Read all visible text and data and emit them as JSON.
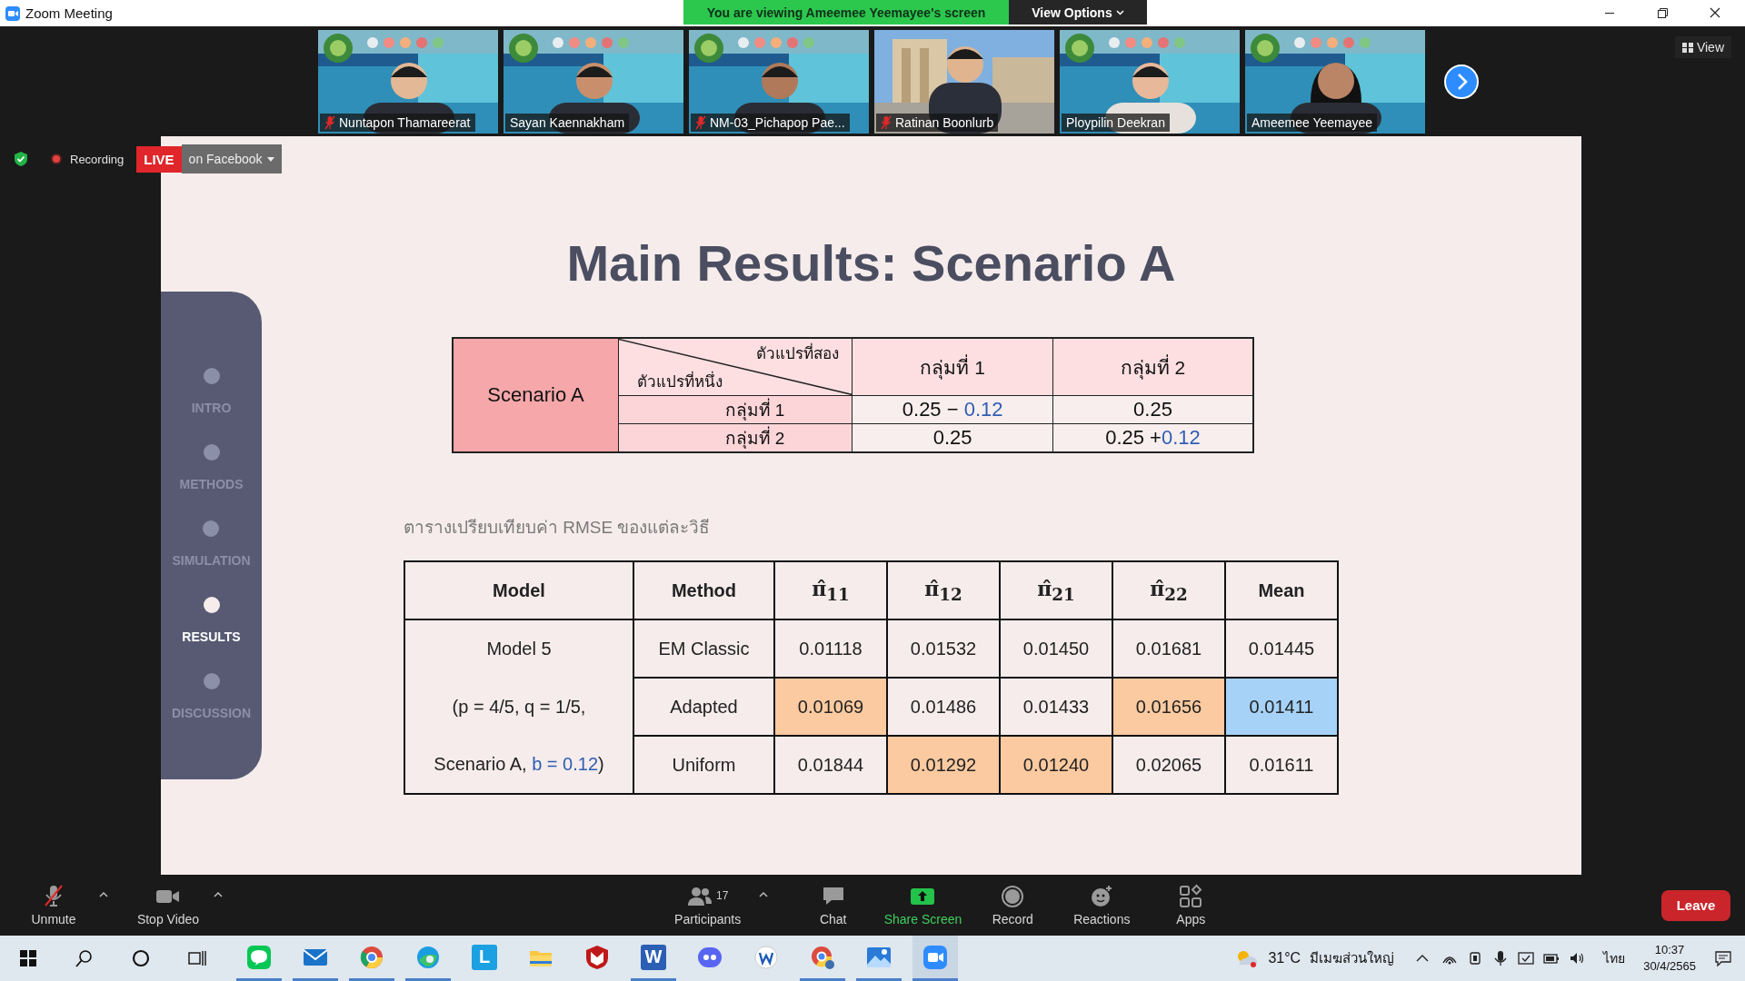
{
  "window": {
    "title": "Zoom Meeting"
  },
  "share_banner": {
    "text": "You are viewing Ameemee Yeemayee's screen",
    "button": "View Options"
  },
  "participants": [
    {
      "name": "Nuntapon Thamareerat",
      "muted": true
    },
    {
      "name": "Sayan Kaennakham",
      "muted": false
    },
    {
      "name": "NM-03_Pichapop Pae...",
      "muted": true
    },
    {
      "name": "Ratinan Boonlurb",
      "muted": true
    },
    {
      "name": "Ploypilin Deekran",
      "muted": false
    },
    {
      "name": "Ameemee Yeemayee",
      "muted": false
    }
  ],
  "view_button": "View",
  "recording": {
    "label": "Recording",
    "live": "LIVE",
    "destination": "on Facebook"
  },
  "slide": {
    "title": "Main Results: Scenario A",
    "nav": [
      {
        "label": "INTRO",
        "selected": false
      },
      {
        "label": "METHODS",
        "selected": false
      },
      {
        "label": "SIMULATION",
        "selected": false
      },
      {
        "label": "RESULTS",
        "selected": true
      },
      {
        "label": "DISCUSSION",
        "selected": false
      }
    ],
    "scenario_table": {
      "label": "Scenario A",
      "column_header": "ตัวแปรที่สอง",
      "row_header": "ตัวแปรที่หนึ่ง",
      "columns": [
        "กลุ่มที่ 1",
        "กลุ่มที่ 2"
      ],
      "rows": [
        {
          "label": "กลุ่มที่ 1",
          "cells": [
            [
              {
                "text": "0.25 − ",
                "accent": false
              },
              {
                "text": "0.12",
                "accent": true
              }
            ],
            [
              {
                "text": "0.25",
                "accent": false
              }
            ]
          ]
        },
        {
          "label": "กลุ่มที่ 2",
          "cells": [
            [
              {
                "text": "0.25",
                "accent": false
              }
            ],
            [
              {
                "text": "0.25 +",
                "accent": false
              },
              {
                "text": "0.12",
                "accent": true
              }
            ]
          ]
        }
      ]
    },
    "caption": "ตารางเปรียบเทียบค่า RMSE ของแต่ละวิธี",
    "rmse_table": {
      "columns": [
        "Model",
        "Method",
        "π̂$_{11}$",
        "π̂$_{12}$",
        "π̂$_{21}$",
        "π̂$_{22}$",
        "Mean"
      ],
      "rows": [
        {
          "cells": [
            {
              "text": "Model 5"
            },
            {
              "text": "EM Classic"
            },
            {
              "text": "0.01118"
            },
            {
              "text": "0.01532"
            },
            {
              "text": "0.01450"
            },
            {
              "text": "0.01681"
            },
            {
              "text": "0.01445"
            }
          ]
        },
        {
          "cells": [
            {
              "parts": [
                {
                  "text": "(p = 4/5, q = 1/5,",
                  "accent": false
                }
              ]
            },
            {
              "text": "Adapted"
            },
            {
              "text": "0.01069",
              "color": "#fccaa0"
            },
            {
              "text": "0.01486"
            },
            {
              "text": "0.01433"
            },
            {
              "text": "0.01656",
              "color": "#fccaa0"
            },
            {
              "text": "0.01411",
              "color": "#a6d2f8"
            }
          ]
        },
        {
          "cells": [
            {
              "parts": [
                {
                  "text": "Scenario A, ",
                  "accent": false
                },
                {
                  "text": "b = 0.12",
                  "accent": true
                },
                {
                  "text": ")",
                  "accent": false
                }
              ]
            },
            {
              "text": "Uniform"
            },
            {
              "text": "0.01844"
            },
            {
              "text": "0.01292",
              "color": "#fccaa0"
            },
            {
              "text": "0.01240",
              "color": "#fccaa0"
            },
            {
              "text": "0.02065"
            },
            {
              "text": "0.01611"
            }
          ]
        }
      ]
    }
  },
  "toolbar": {
    "items": [
      {
        "kind": "mic",
        "label": "Unmute",
        "muted": true,
        "menu": true
      },
      {
        "kind": "video",
        "label": "Stop Video",
        "menu": true
      },
      {
        "kind": "participants",
        "label": "Participants",
        "count": "17",
        "menu": true
      },
      {
        "kind": "chat",
        "label": "Chat",
        "menu": false
      },
      {
        "kind": "share",
        "label": "Share Screen",
        "menu": false
      },
      {
        "kind": "record",
        "label": "Record",
        "menu": false
      },
      {
        "kind": "reactions",
        "label": "Reactions",
        "menu": false
      },
      {
        "kind": "apps",
        "label": "Apps",
        "menu": false
      }
    ],
    "leave": "Leave"
  },
  "taskbar": {
    "apps": [
      {
        "running": true
      },
      {
        "running": true
      },
      {
        "running": true
      },
      {
        "running": true
      },
      {
        "running": false,
        "glyph": "L"
      },
      {
        "running": false
      },
      {
        "running": false
      },
      {
        "running": true,
        "glyph": "W"
      },
      {
        "running": false
      },
      {
        "running": false
      },
      {
        "running": true
      },
      {
        "running": true
      },
      {
        "running": true,
        "active": true
      }
    ],
    "tray": {
      "temperature": "31°C",
      "weather": "มีเมฆส่วนใหญ่",
      "language": "ไทย",
      "time": "10:37",
      "date": "30/4/2565"
    }
  }
}
